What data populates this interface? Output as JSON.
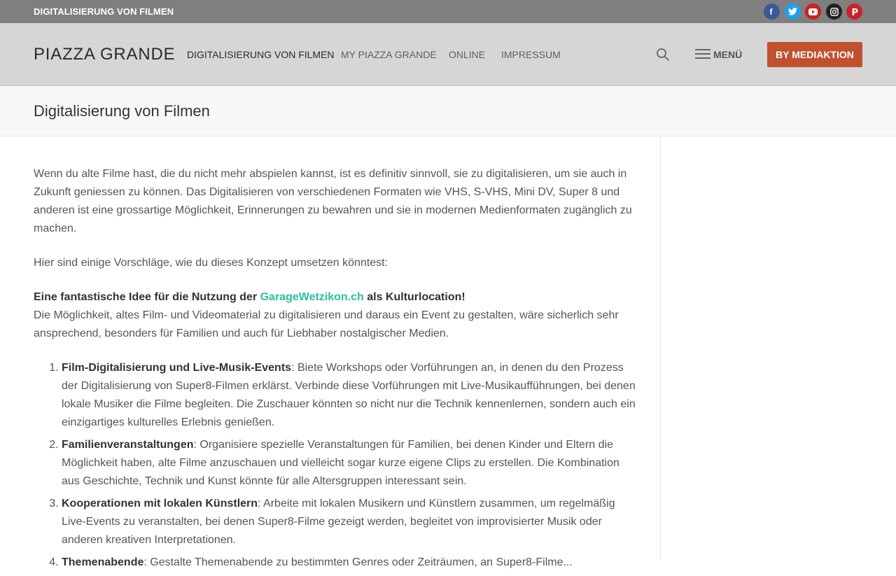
{
  "topbar": {
    "title": "DIGITALISIERUNG VON FILMEN",
    "social": [
      {
        "name": "facebook",
        "icon": "facebook-icon",
        "color": "#3b5998",
        "glyph": "f"
      },
      {
        "name": "twitter",
        "icon": "twitter-icon",
        "color": "#1da1f2"
      },
      {
        "name": "youtube",
        "icon": "youtube-icon",
        "color": "#cd201f"
      },
      {
        "name": "instagram",
        "icon": "instagram-icon",
        "color": "#222222"
      },
      {
        "name": "pinterest",
        "icon": "pinterest-icon",
        "color": "#c8232c",
        "glyph": "P"
      }
    ]
  },
  "header": {
    "logo": "PIAZZA GRANDE",
    "nav": [
      {
        "label": "DIGITALISIERUNG VON FILMEN",
        "active": true
      },
      {
        "label": "MY PIAZZA GRANDE"
      },
      {
        "label": "ONLINE"
      },
      {
        "label": "IMPRESSUM"
      }
    ],
    "menu_label": "MENÜ",
    "cta_label": "BY MEDIAKTION",
    "cta_color": "#c0512f"
  },
  "page": {
    "title": "Digitalisierung von Filmen"
  },
  "content": {
    "intro": "Wenn du alte Filme hast, die du nicht mehr abspielen kannst, ist es definitiv sinnvoll, sie zu digitalisieren, um sie auch in Zukunft geniessen zu können. Das Digitalisieren von verschiedenen Formaten wie VHS, S-VHS, Mini DV, Super 8 und anderen ist eine grossartige Möglichkeit, Erinnerungen zu bewahren und sie in modernen Medienformaten zugänglich zu machen.",
    "suggestions": "Hier sind einige Vorschläge, wie du dieses Konzept umsetzen könntest:",
    "idea_prefix": "Eine fantastische Idee für die Nutzung der ",
    "idea_link": "GarageWetzikon.ch",
    "idea_suffix": " als Kulturlocation!",
    "idea_text": "Die Möglichkeit, altes Film- und Videomaterial zu digitalisieren und daraus ein Event zu gestalten, wäre sicherlich sehr ansprechend, besonders für Familien und auch für Liebhaber nostalgischer Medien.",
    "list": [
      {
        "title": "Film-Digitalisierung und Live-Musik-Events",
        "text": ": Biete Workshops oder Vorführungen an, in denen du den Prozess der Digitalisierung von Super8-Filmen erklärst. Verbinde diese Vorführungen mit Live-Musikaufführungen, bei denen lokale Musiker die Filme begleiten. Die Zuschauer könnten so nicht nur die Technik kennenlernen, sondern auch ein einzigartiges kulturelles Erlebnis genießen."
      },
      {
        "title": "Familienveranstaltungen",
        "text": ": Organisiere spezielle Veranstaltungen für Familien, bei denen Kinder und Eltern die Möglichkeit haben, alte Filme anzuschauen und vielleicht sogar kurze eigene Clips zu erstellen. Die Kombination aus Geschichte, Technik und Kunst könnte für alle Altersgruppen interessant sein."
      },
      {
        "title": "Kooperationen mit lokalen Künstlern",
        "text": ": Arbeite mit lokalen Musikern und Künstlern zusammen, um regelmäßig Live-Events zu veranstalten, bei denen Super8-Filme gezeigt werden, begleitet von improvisierter Musik oder anderen kreativen Interpretationen."
      },
      {
        "title": "Themenabende",
        "text": ": Gestalte Themenabende zu bestimmten Genres oder Zeiträumen, an Super8-Filme..."
      }
    ]
  }
}
